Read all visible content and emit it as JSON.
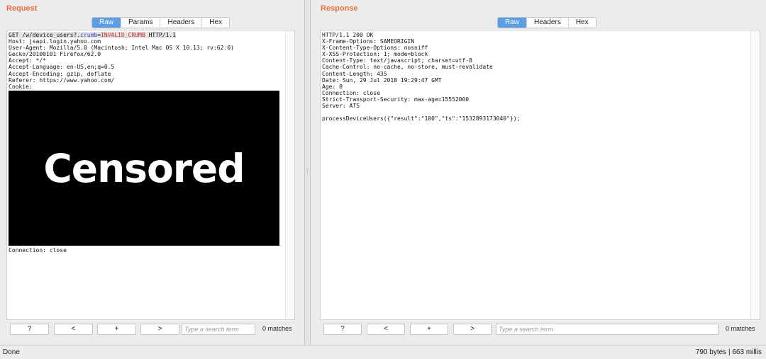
{
  "request": {
    "title": "Request",
    "tabs": [
      "Raw",
      "Params",
      "Headers",
      "Hex"
    ],
    "active_tab": "Raw",
    "line1": {
      "method_path": "GET /w/device_users?.",
      "param": "crumb",
      "eq": "=",
      "value": "INVALID_CRUMB",
      "proto": " HTTP/1.1"
    },
    "lines": [
      "Host: jsapi.login.yahoo.com",
      "User-Agent: Mozilla/5.0 (Macintosh; Intel Mac OS X 10.13; rv:62.0)",
      "Gecko/20100101 Firefox/62.0",
      "Accept: */*",
      "Accept-Language: en-US,en;q=0.5",
      "Accept-Encoding: gzip, deflate",
      "Referer: https://www.yahoo.com/",
      "Cookie:"
    ],
    "censor_text": "Censored",
    "tail": "Connection: close",
    "search_placeholder": "Type a search term",
    "matches": "0 matches",
    "buttons": [
      "?",
      "<",
      "+",
      ">"
    ]
  },
  "response": {
    "title": "Response",
    "tabs": [
      "Raw",
      "Headers",
      "Hex"
    ],
    "active_tab": "Raw",
    "lines": [
      "HTTP/1.1 200 OK",
      "X-Frame-Options: SAMEORIGIN",
      "X-Content-Type-Options: nosniff",
      "X-XSS-Protection: 1; mode=block",
      "Content-Type: text/javascript; charset=utf-8",
      "Cache-Control: no-cache, no-store, must-revalidate",
      "Content-Length: 435",
      "Date: Sun, 29 Jul 2018 19:29:47 GMT",
      "Age: 0",
      "Connection: close",
      "Strict-Transport-Security: max-age=15552000",
      "Server: ATS",
      "",
      "processDeviceUsers({\"result\":\"100\",\"ts\":\"1532893173040\"});"
    ],
    "search_placeholder": "Type a search term",
    "matches": "0 matches",
    "buttons": [
      "?",
      "<",
      "+",
      ">"
    ]
  },
  "status": {
    "left": "Done",
    "right": "790 bytes | 663 millis"
  },
  "colors": {
    "title": "#e8743b",
    "active_tab": "#5b9ee5",
    "param_key": "#2c49c9",
    "param_value": "#c82a2a"
  }
}
